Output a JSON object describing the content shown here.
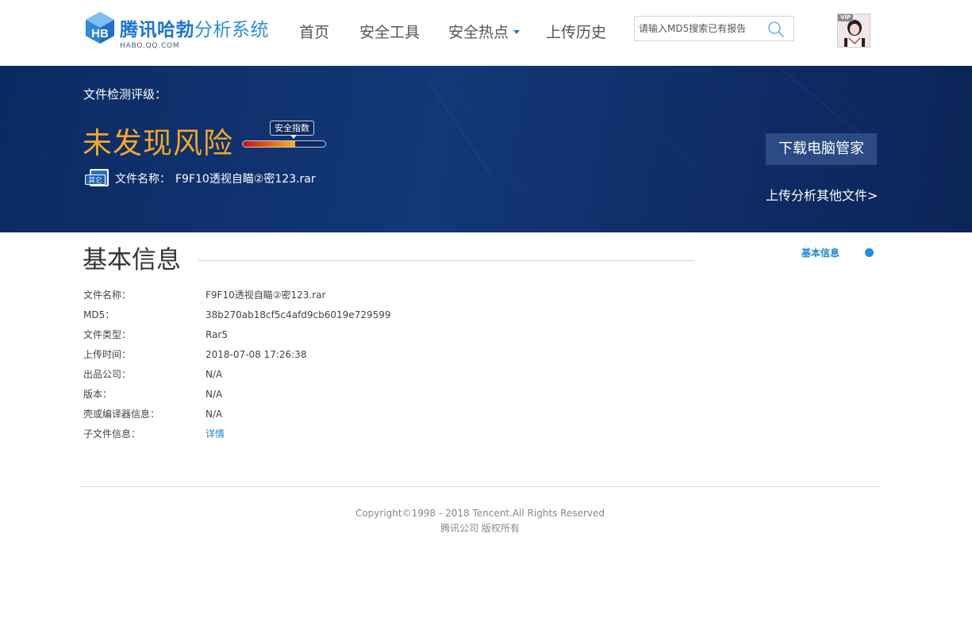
{
  "header": {
    "logo": {
      "mark_text": "HB",
      "brand": "腾讯哈勃",
      "system": "分析系统",
      "domain": "HABO.QQ.COM"
    },
    "nav": [
      {
        "label": "首页"
      },
      {
        "label": "安全工具"
      },
      {
        "label": "安全热点",
        "has_dropdown": true
      },
      {
        "label": "上传历史"
      }
    ],
    "search": {
      "placeholder": "请输入MD5搜索已有报告",
      "value": "",
      "icon": "search-icon"
    },
    "avatar": {
      "badge": "VIP",
      "icon": "user-avatar"
    }
  },
  "banner": {
    "rating_label": "文件检测评级：",
    "result": "未发现风险",
    "safety_index_label": "安全指数",
    "safety_index_level": 0.63,
    "file_type_badge": "其它",
    "file_name_label": "文件名称：",
    "file_name": "F9F10透视自瞄②密123.rar",
    "download_button": "下载电脑管家",
    "upload_other_link": "上传分析其他文件>"
  },
  "basic_info": {
    "title": "基本信息",
    "side_anchor": "基本信息",
    "rows": [
      {
        "key": "文件名称：",
        "value": "F9F10透视自瞄②密123.rar"
      },
      {
        "key": "MD5：",
        "value": "38b270ab18cf5c4afd9cb6019e729599"
      },
      {
        "key": "文件类型：",
        "value": "Rar5"
      },
      {
        "key": "上传时间：",
        "value": "2018-07-08 17:26:38"
      },
      {
        "key": "出品公司：",
        "value": "N/A"
      },
      {
        "key": "版本：",
        "value": "N/A"
      },
      {
        "key": "壳或编译器信息：",
        "value": "N/A"
      },
      {
        "key": "子文件信息：",
        "value": "详情",
        "is_link": true
      }
    ]
  },
  "footer": {
    "copyright": "Copyright©1998 - 2018 Tencent.All Rights Reserved",
    "company": "腾讯公司 版权所有"
  },
  "colors": {
    "brand_blue": "#1b74d1",
    "banner_bg": "#0f2c66",
    "risk_orange": "#f5a623",
    "link_blue": "#1a85d6"
  }
}
